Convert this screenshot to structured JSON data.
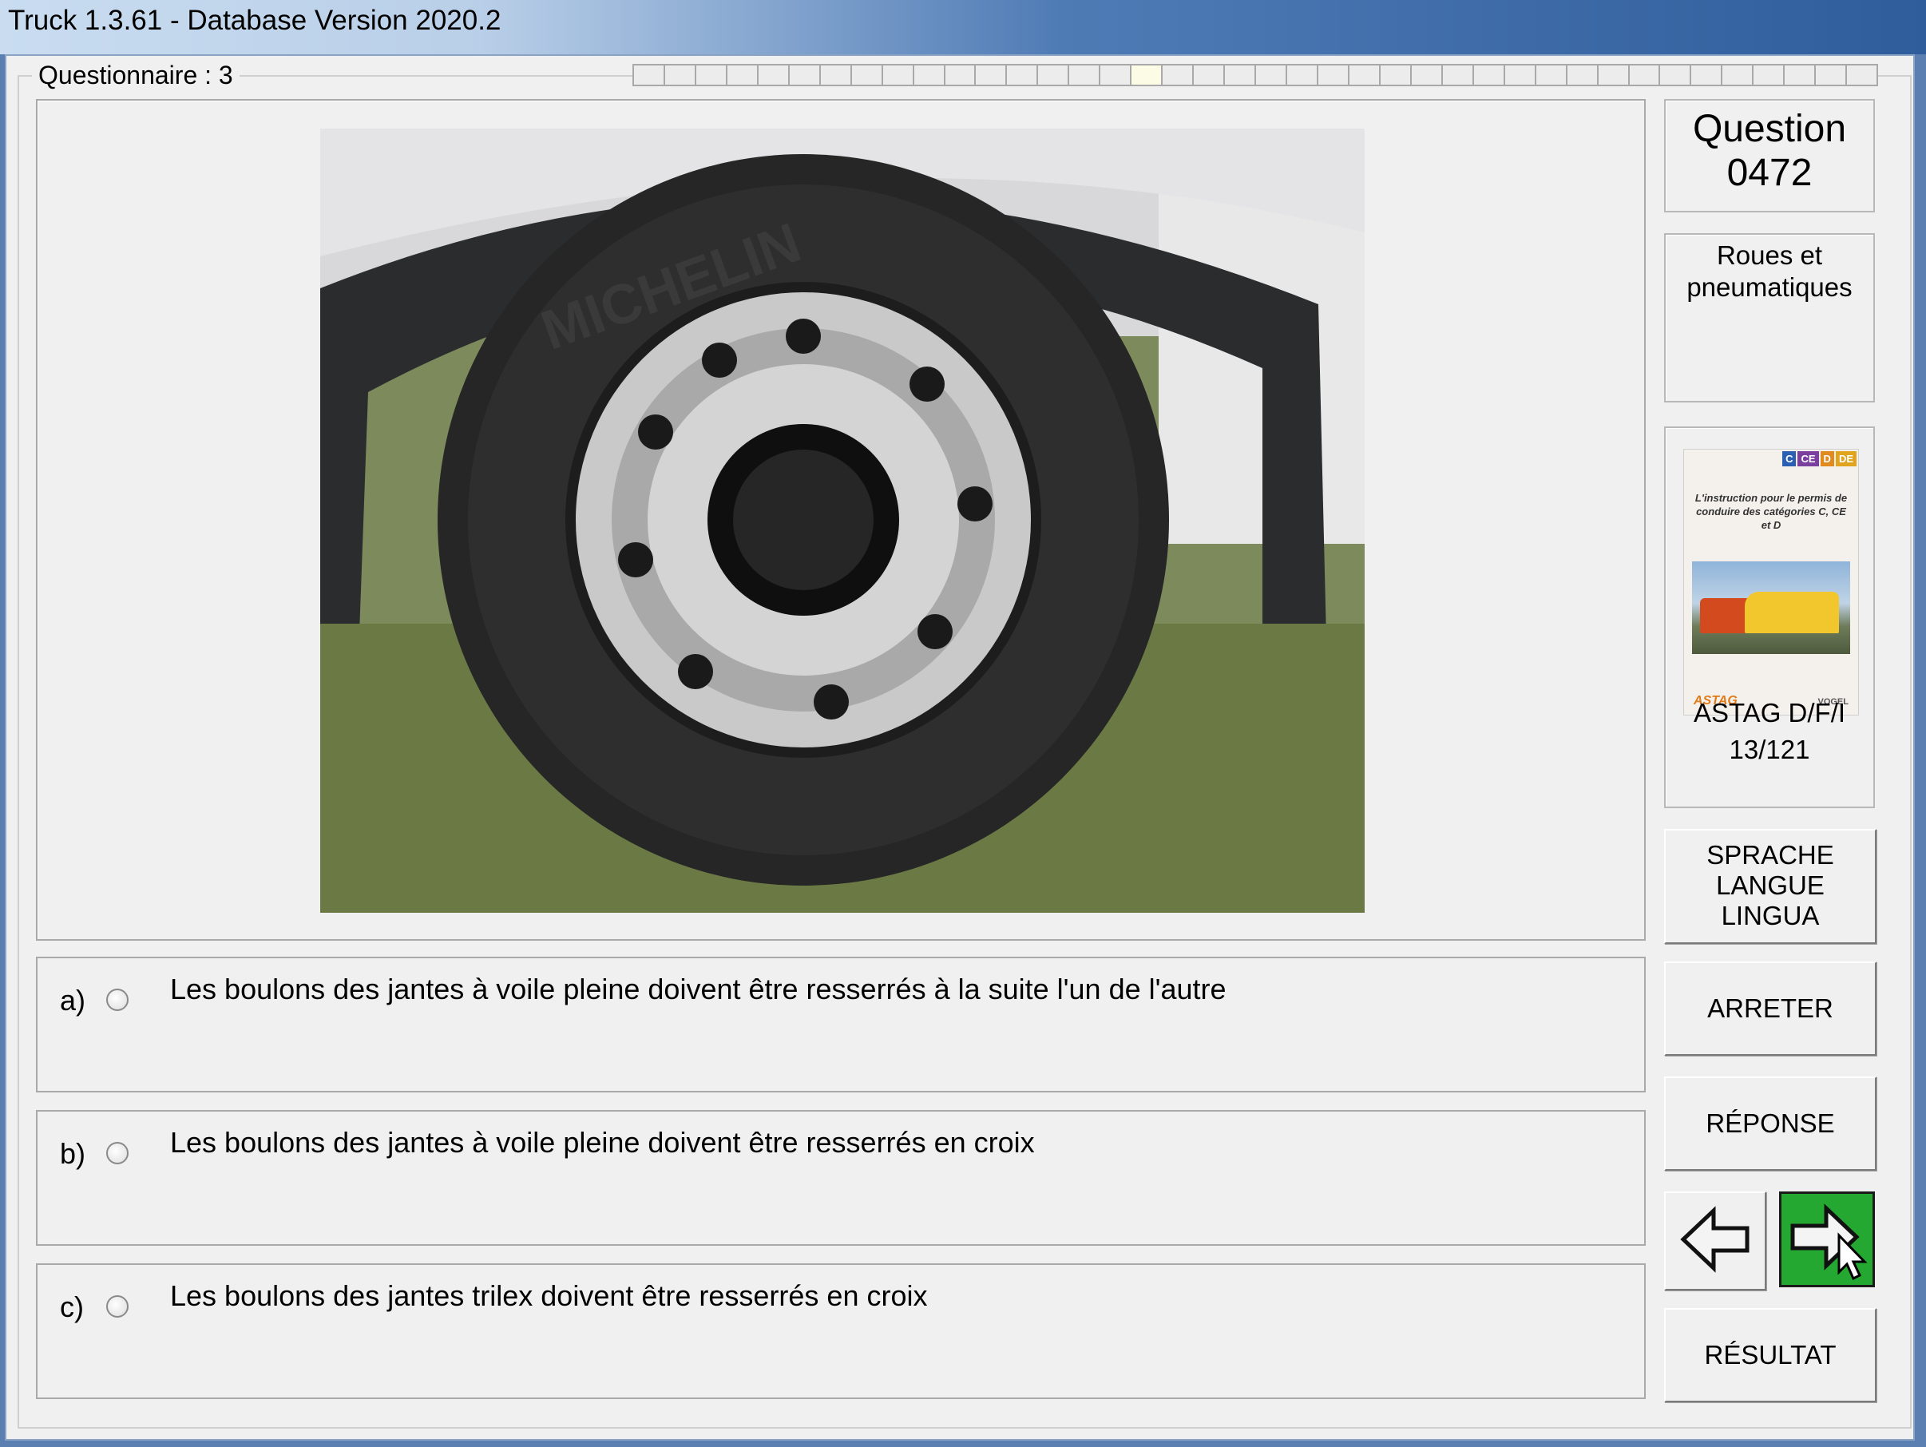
{
  "window": {
    "title": "Truck 1.3.61 - Database Version 2020.2"
  },
  "questionnaire": {
    "label": "Questionnaire : 3"
  },
  "progress": {
    "segments": 40,
    "current": 16
  },
  "question": {
    "label": "Question",
    "number": "0472"
  },
  "category": {
    "line1": "Roues et",
    "line2": "pneumatiques"
  },
  "reference": {
    "book_tags": [
      "C",
      "CE",
      "D",
      "DE"
    ],
    "book_desc": "L'instruction pour le permis de conduire des catégories C, CE et D",
    "book_logo_left": "ASTAG",
    "book_logo_right": "VOGEL",
    "line1": "ASTAG D/F/I",
    "line2": "13/121"
  },
  "answers": [
    {
      "letter": "a)",
      "text": "Les boulons des jantes à voile pleine doivent être resserrés à la suite l'un de l'autre"
    },
    {
      "letter": "b)",
      "text": "Les boulons des jantes à voile pleine doivent être resserrés en croix"
    },
    {
      "letter": "c)",
      "text": "Les boulons des jantes trilex doivent être resserrés en croix"
    }
  ],
  "buttons": {
    "language_1": "SPRACHE",
    "language_2": "LANGUE",
    "language_3": "LINGUA",
    "stop": "ARRETER",
    "answer": "RÉPONSE",
    "result": "RÉSULTAT"
  },
  "colors": {
    "next_button": "#25a832",
    "tag_c": "#2b5fb4",
    "tag_ce": "#7b3fa0",
    "tag_d": "#e08a1f"
  },
  "icons": {
    "prev": "left-arrow-icon",
    "next": "right-arrow-icon",
    "cursor": "mouse-pointer-icon"
  }
}
